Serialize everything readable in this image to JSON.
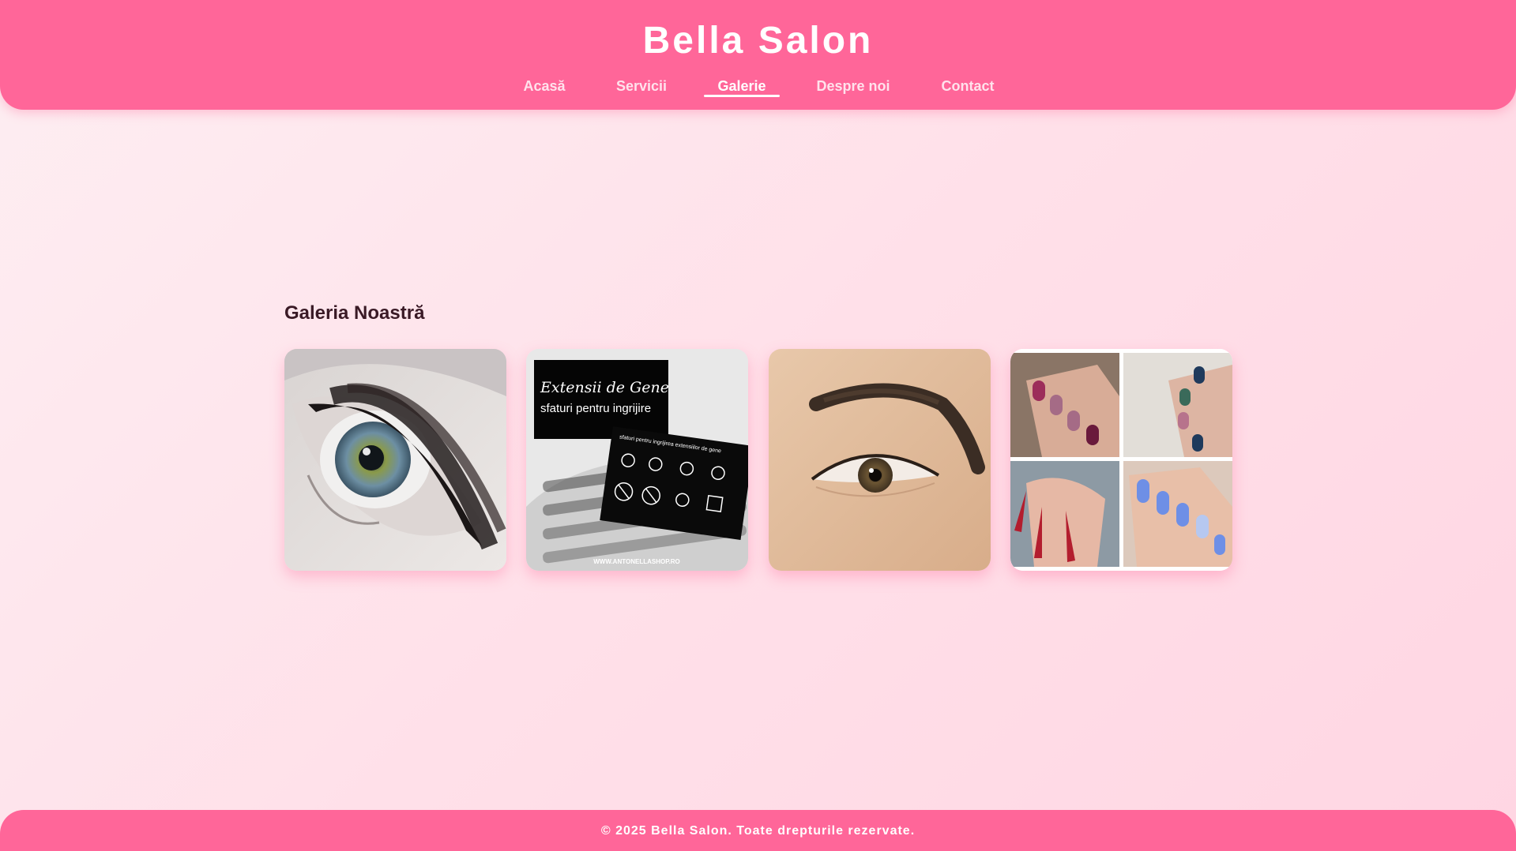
{
  "brand": {
    "title": "Bella Salon",
    "accent_color": "#ff6699",
    "background_color": "#ffe4ec"
  },
  "nav": {
    "items": [
      {
        "label": "Acasă",
        "active": false
      },
      {
        "label": "Servicii",
        "active": false
      },
      {
        "label": "Galerie",
        "active": true
      },
      {
        "label": "Despre noi",
        "active": false
      },
      {
        "label": "Contact",
        "active": false
      }
    ]
  },
  "gallery": {
    "title": "Galeria Noastră",
    "images": [
      {
        "subject": "eyelash-extensions-closeup"
      },
      {
        "subject": "eyelash-care-card",
        "card_title": "Extensii de Gene",
        "card_subtitle": "sfaturi pentru ingrijire",
        "card_heading": "sfaturi pentru ingrijirea extensiilor de gene",
        "card_url": "WWW.ANTONELLASHOP.RO"
      },
      {
        "subject": "eyebrow-styling-closeup"
      },
      {
        "subject": "manicure-collage"
      }
    ]
  },
  "footer": {
    "text": "© 2025 Bella Salon. Toate drepturile rezervate."
  }
}
